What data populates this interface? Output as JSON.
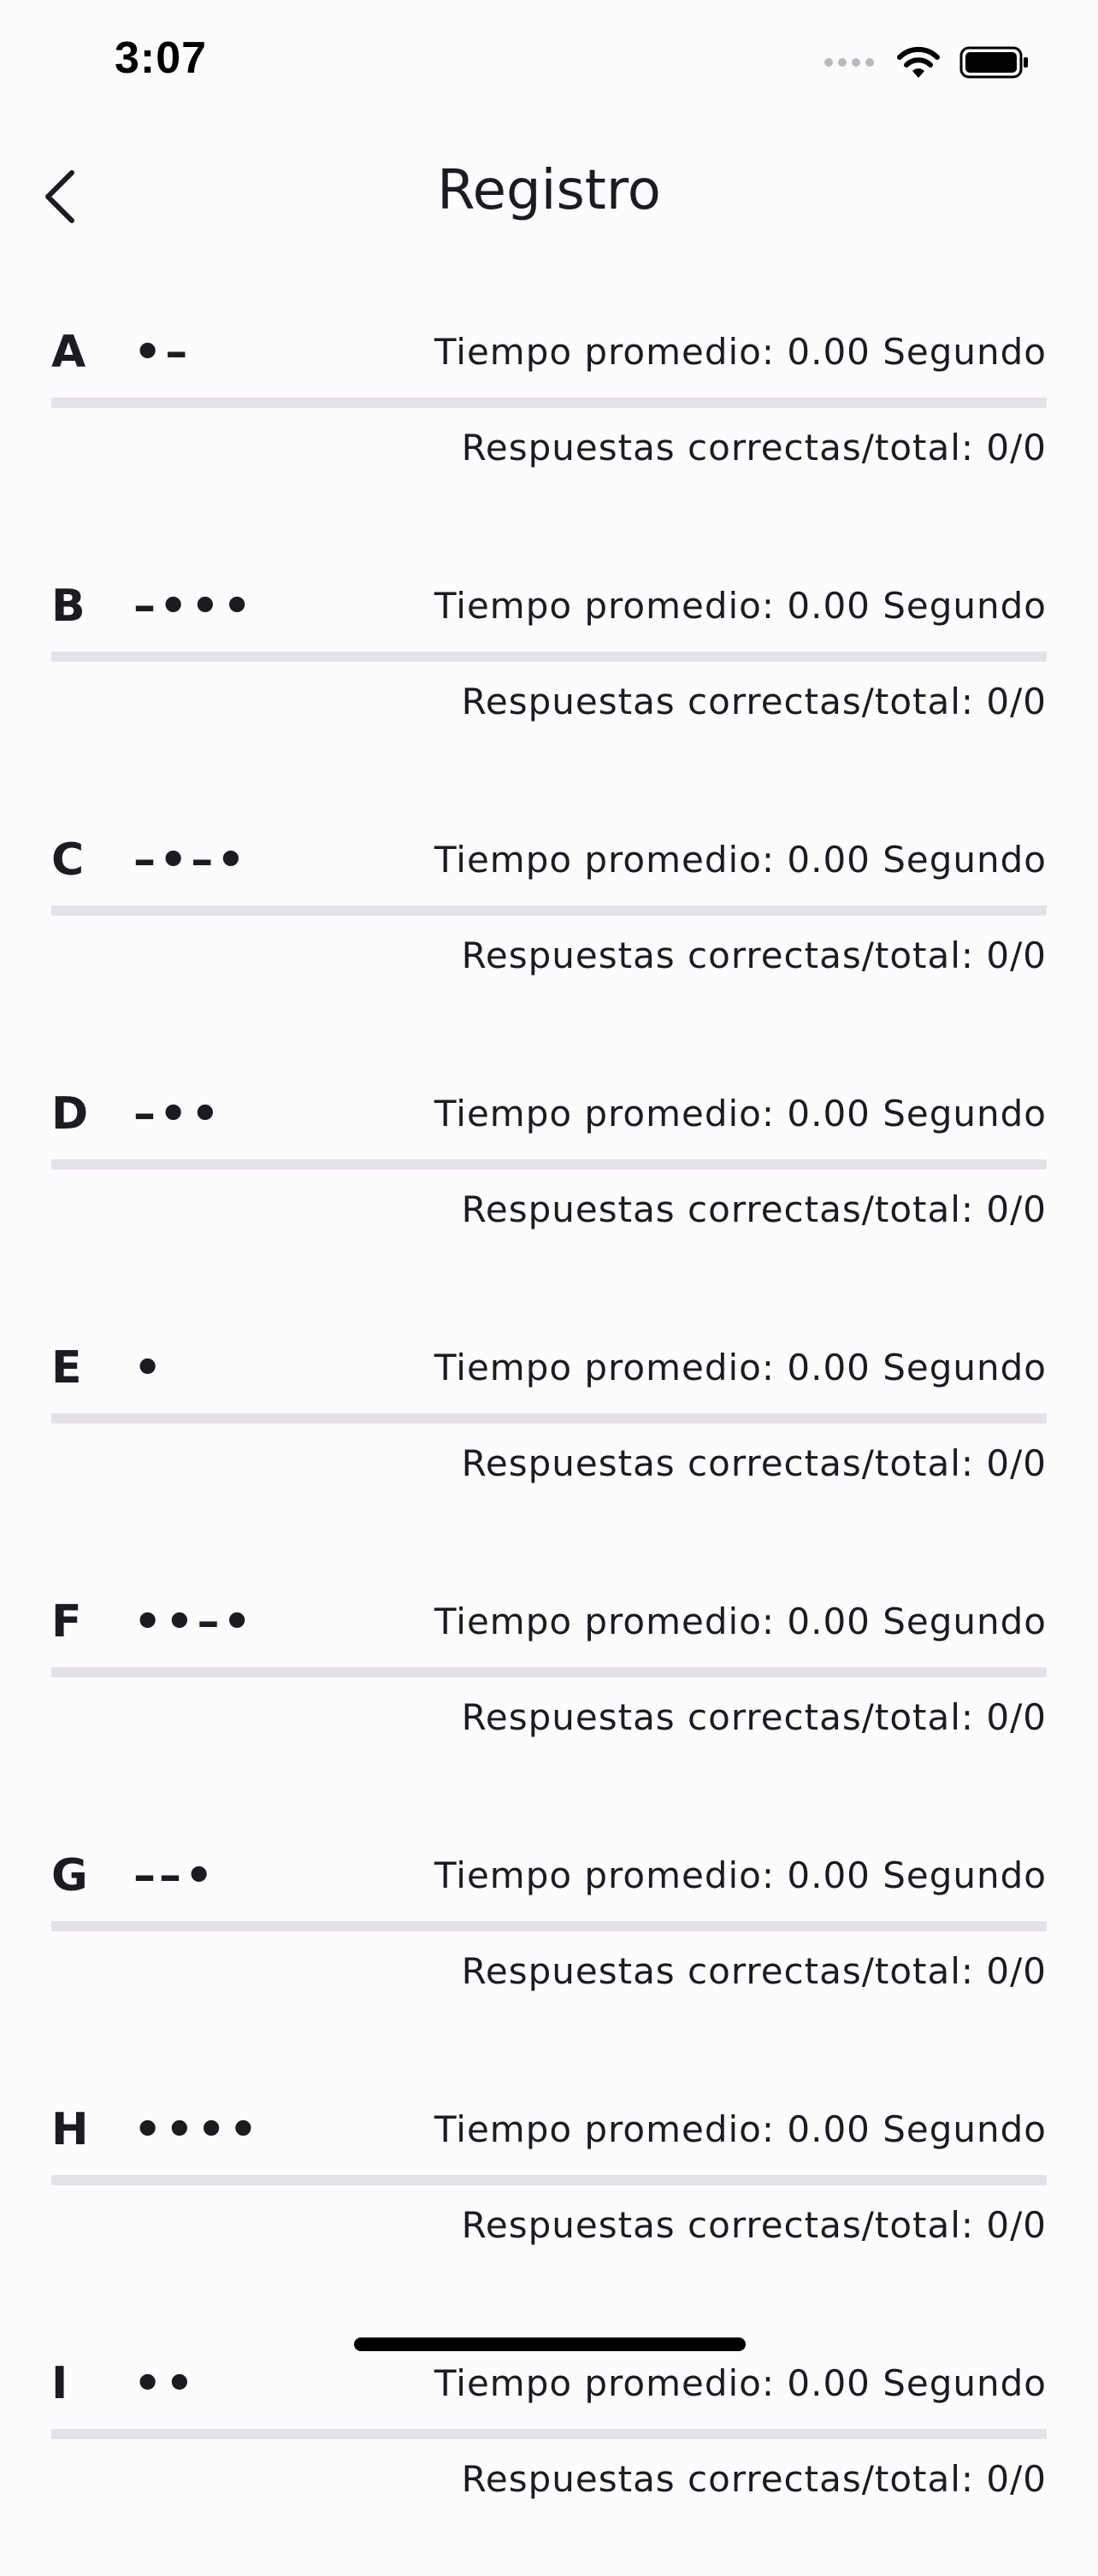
{
  "status_bar": {
    "time": "3:07",
    "icons": [
      "cellular-signal-icon",
      "wifi-icon",
      "battery-icon"
    ]
  },
  "header": {
    "title": "Registro",
    "back_icon": "chevron-left-icon"
  },
  "colors": {
    "background": "#fdfbfd",
    "text": "#1c1b1f",
    "progress_track": "#e5e1e9",
    "progress_fill": "#6750a4"
  },
  "records": [
    {
      "letter": "A",
      "morse": "•–",
      "avg_time": "Tiempo promedio: 0.00 Segundo",
      "correct": "Respuestas correctas/total: 0/0",
      "progress": 0
    },
    {
      "letter": "B",
      "morse": "–•••",
      "avg_time": "Tiempo promedio: 0.00 Segundo",
      "correct": "Respuestas correctas/total: 0/0",
      "progress": 0
    },
    {
      "letter": "C",
      "morse": "–•–•",
      "avg_time": "Tiempo promedio: 0.00 Segundo",
      "correct": "Respuestas correctas/total: 0/0",
      "progress": 0
    },
    {
      "letter": "D",
      "morse": "–••",
      "avg_time": "Tiempo promedio: 0.00 Segundo",
      "correct": "Respuestas correctas/total: 0/0",
      "progress": 0
    },
    {
      "letter": "E",
      "morse": "•",
      "avg_time": "Tiempo promedio: 0.00 Segundo",
      "correct": "Respuestas correctas/total: 0/0",
      "progress": 0
    },
    {
      "letter": "F",
      "morse": "••–•",
      "avg_time": "Tiempo promedio: 0.00 Segundo",
      "correct": "Respuestas correctas/total: 0/0",
      "progress": 0
    },
    {
      "letter": "G",
      "morse": "––•",
      "avg_time": "Tiempo promedio: 0.00 Segundo",
      "correct": "Respuestas correctas/total: 0/0",
      "progress": 0
    },
    {
      "letter": "H",
      "morse": "••••",
      "avg_time": "Tiempo promedio: 0.00 Segundo",
      "correct": "Respuestas correctas/total: 0/0",
      "progress": 0
    },
    {
      "letter": "I",
      "morse": "••",
      "avg_time": "Tiempo promedio: 0.00 Segundo",
      "correct": "Respuestas correctas/total: 0/0",
      "progress": 0
    }
  ]
}
